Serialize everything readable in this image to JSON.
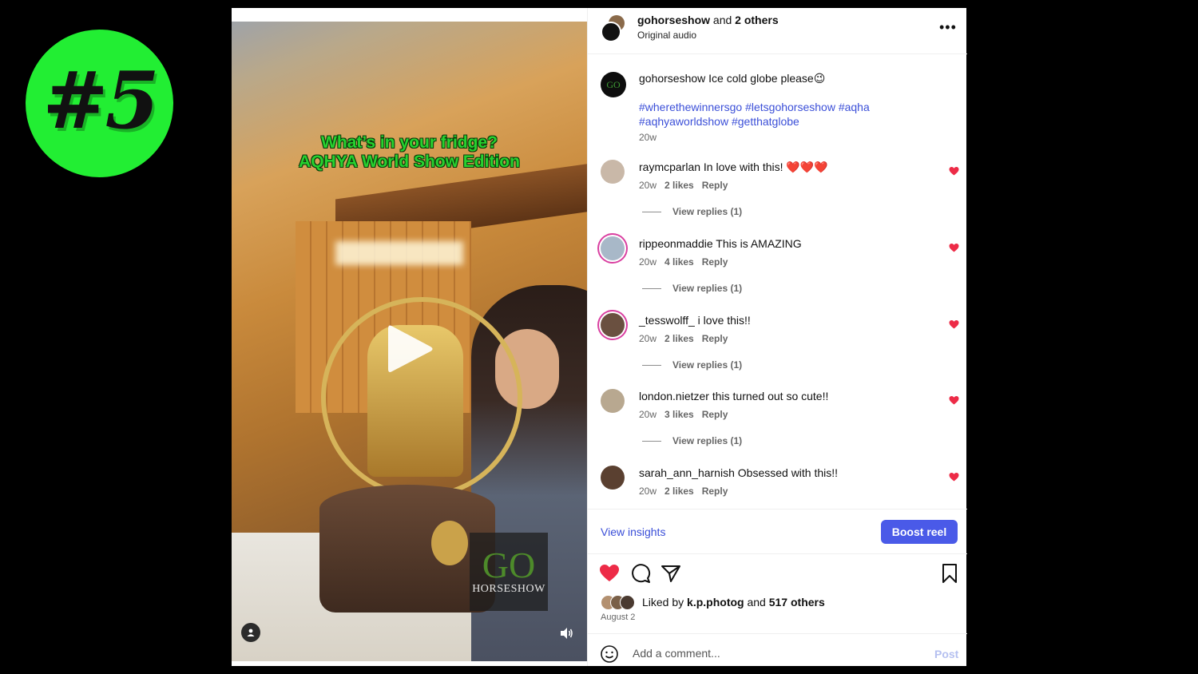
{
  "badge": {
    "text": "#5",
    "color": "#22ee33"
  },
  "media": {
    "overlay_line1": "What’s in your fridge?",
    "overlay_line2": "AQHYA World Show Edition",
    "watermark_go": "GO",
    "watermark_sub": "HORSESHOW",
    "play_icon": "play-icon",
    "sound_icon": "speaker-icon",
    "user_icon": "person-icon"
  },
  "header": {
    "username": "gohorseshow",
    "and_text": "and",
    "others": "2 others",
    "subtitle": "Original audio",
    "more_icon": "•••"
  },
  "caption": {
    "username": "gohorseshow",
    "text": "Ice cold globe please😉",
    "hashtags": "#wherethewinnersgo #letsgohorseshow #aqha #aqhyaworldshow #getthatglobe",
    "time": "20w",
    "avatar_text": "GO"
  },
  "comments": [
    {
      "user": "raymcparlan",
      "text": "In love with this! ❤️❤️❤️",
      "time": "20w",
      "likes": "2 likes",
      "reply": "Reply",
      "replies": "View replies (1)",
      "avatar_color": "#c9b8a8"
    },
    {
      "user": "rippeonmaddie",
      "text": "This is AMAZING",
      "time": "20w",
      "likes": "4 likes",
      "reply": "Reply",
      "replies": "View replies (1)",
      "avatar_color": "#a8b8c8"
    },
    {
      "user": "_tesswolff_",
      "text": "i love this!!",
      "time": "20w",
      "likes": "2 likes",
      "reply": "Reply",
      "replies": "View replies (1)",
      "avatar_color": "#6a5040"
    },
    {
      "user": "london.nietzer",
      "text": "this turned out so cute!!",
      "time": "20w",
      "likes": "3 likes",
      "reply": "Reply",
      "replies": "View replies (1)",
      "avatar_color": "#b8a890"
    },
    {
      "user": "sarah_ann_harnish",
      "text": "Obsessed with this!!",
      "time": "20w",
      "likes": "2 likes",
      "reply": "Reply",
      "avatar_color": "#5a4030"
    }
  ],
  "insights": {
    "view_label": "View insights",
    "boost_label": "Boost reel"
  },
  "likes": {
    "prefix": "Liked by",
    "user": "k.p.photog",
    "and_text": "and",
    "others": "517 others",
    "date": "August 2"
  },
  "comment_box": {
    "placeholder": "Add a comment...",
    "post_label": "Post"
  },
  "colors": {
    "link": "#3b4fd8",
    "heart": "#ed2b47",
    "boost": "#4a5ae8"
  }
}
